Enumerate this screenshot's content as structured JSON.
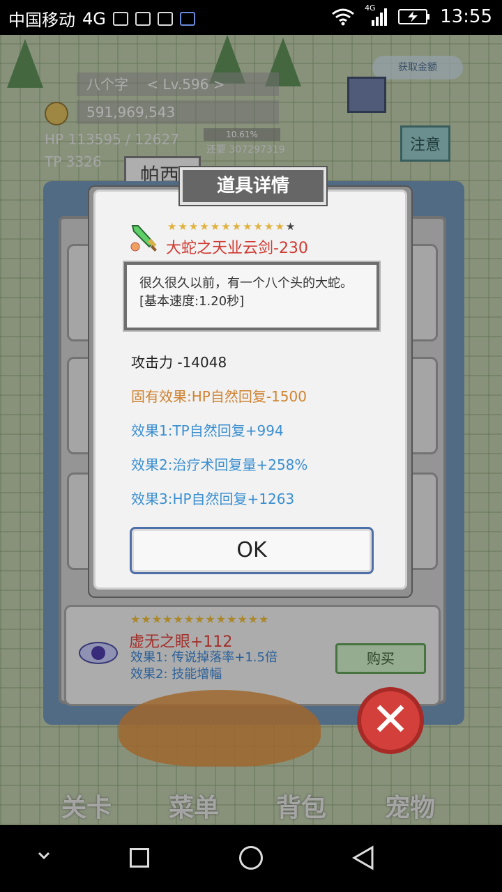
{
  "status_bar": {
    "carrier": "中国移动",
    "network": "4G",
    "net_small": "4G",
    "time": "13:55"
  },
  "hud": {
    "player": "八个字",
    "level": "< Lv.596 >",
    "gold": "591,969,543",
    "hp": "113595 / 12627",
    "tp": "3326",
    "exp_percent": "10.61%",
    "exp_need": "还要 307297319",
    "notice": "注意",
    "gift_label": "获取金额",
    "tab_partial": "帕西"
  },
  "shop_bottom_item": {
    "stars": "★★★★★★★★★★★★★",
    "name": "虚无之眼+112",
    "effect1": "效果1: 传说掉落率+1.5倍",
    "effect2": "效果2: 技能增幅",
    "buy": "购买"
  },
  "bottom_nav": [
    "关卡",
    "菜单",
    "背包",
    "宠物"
  ],
  "dialog": {
    "title": "道具详情",
    "stars_filled": "★★★★★★★★★★★",
    "stars_empty": "★",
    "item_name": "大蛇之天业云剑-230",
    "desc1": "很久很久以前，有一个八个头的大蛇。",
    "desc2": "[基本速度:1.20秒]",
    "attack": "攻击力  -14048",
    "fixed_effect": "固有效果:HP自然回复-1500",
    "effect1": "效果1:TP自然回复+994",
    "effect2": "效果2:治疗术回复量+258%",
    "effect3": "效果3:HP自然回复+1263",
    "ok": "OK"
  },
  "colors": {
    "item_name": "#d03a32",
    "fixed_effect": "#cf8332",
    "effect": "#3b8fd1",
    "close_button": "#d33f3a"
  }
}
